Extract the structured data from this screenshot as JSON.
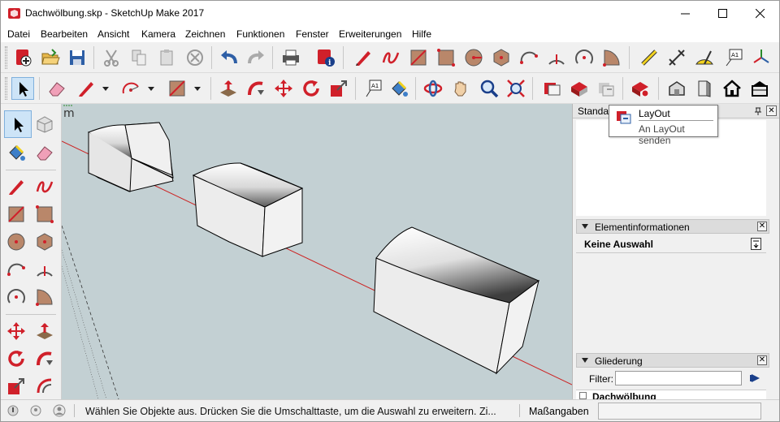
{
  "window": {
    "title": "Dachwölbung.skp - SketchUp Make 2017",
    "controls": {
      "minimize": "minimize",
      "maximize": "maximize",
      "close": "close"
    }
  },
  "menu": [
    "Datei",
    "Bearbeiten",
    "Ansicht",
    "Kamera",
    "Zeichnen",
    "Funktionen",
    "Fenster",
    "Erweiterungen",
    "Hilfe"
  ],
  "toolbar1": {
    "icons": [
      "new-model-icon",
      "open-icon",
      "save-icon",
      "cut-icon",
      "copy-icon",
      "paste-icon",
      "erase-icon",
      "undo-icon",
      "redo-icon",
      "print-icon",
      "model-info-icon",
      "pencil-icon",
      "freehand-icon",
      "rectangle-icon",
      "rotated-rectangle-icon",
      "circle-icon",
      "polygon-icon",
      "arc-icon",
      "two-point-arc-icon",
      "three-point-arc-icon",
      "pie-icon",
      "tape-measure-icon",
      "dimension-icon",
      "protractor-icon",
      "text-icon",
      "axes-icon"
    ],
    "text_tool_label": "A1"
  },
  "toolbar2": {
    "icons": [
      "select-icon",
      "eraser-icon",
      "line-icon",
      "arc-icon",
      "shape-icon",
      "push-pull-icon",
      "follow-me-icon",
      "move-icon",
      "rotate-icon",
      "scale-icon",
      "text-icon",
      "paint-bucket-icon",
      "orbit-icon",
      "pan-icon",
      "zoom-icon",
      "zoom-extents-icon",
      "warehouse-icon",
      "extension-warehouse-icon",
      "send-to-layout-icon",
      "extension-manager-icon",
      "iso-view-icon",
      "front-view-icon",
      "home-view-icon",
      "section-icon"
    ],
    "text_tool_label": "A1"
  },
  "viewport": {
    "background": "#c3d0d3",
    "axis_color": "#cc2222",
    "corner_label": "m"
  },
  "tray": {
    "top_panel_title": "Standa",
    "tooltip": {
      "title": "LayOut",
      "subtitle": "An LayOut senden"
    },
    "entity_info": {
      "title": "Elementinformationen",
      "selection": "Keine Auswahl"
    },
    "outliner": {
      "title": "Gliederung",
      "filter_label": "Filter:",
      "filter_value": "",
      "first_item": "Dachwölbung"
    }
  },
  "status": {
    "text": "Wählen Sie Objekte aus. Drücken Sie die Umschalttaste, um die Auswahl zu erweitern. Zi...",
    "measurements_label": "Maßangaben",
    "measurements_value": ""
  }
}
